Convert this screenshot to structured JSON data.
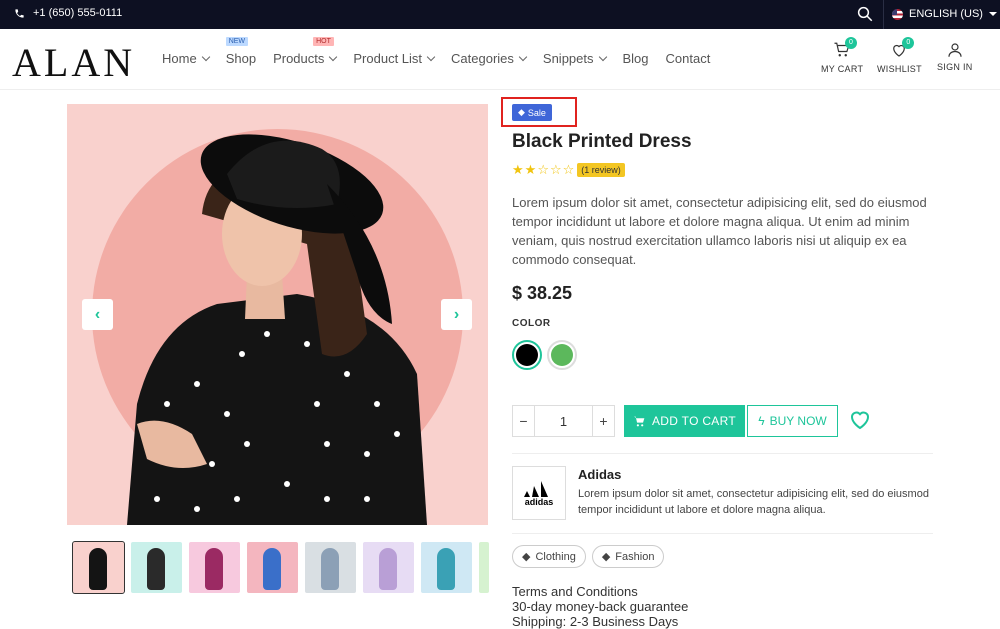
{
  "topbar": {
    "phone": "+1 (650) 555-0111",
    "language": "ENGLISH (US)"
  },
  "header": {
    "logo": "ALAN",
    "nav": [
      {
        "label": "Home",
        "dropdown": true
      },
      {
        "label": "Shop",
        "badge": "NEW",
        "dropdown": false
      },
      {
        "label": "Products",
        "badge": "HOT",
        "dropdown": true
      },
      {
        "label": "Product List",
        "dropdown": true
      },
      {
        "label": "Categories",
        "dropdown": true
      },
      {
        "label": "Snippets",
        "dropdown": true
      },
      {
        "label": "Blog",
        "dropdown": false
      },
      {
        "label": "Contact",
        "dropdown": false
      }
    ],
    "cart": {
      "label": "MY CART",
      "count": "0"
    },
    "wishlist": {
      "label": "WISHLIST",
      "count": "0"
    },
    "signin": {
      "label": "SIGN IN"
    }
  },
  "product": {
    "badge": "Sale",
    "title": "Black Printed Dress",
    "rating": 2,
    "rating_max": 5,
    "review_text": "(1 review)",
    "description": "Lorem ipsum dolor sit amet, consectetur adipisicing elit, sed do eiusmod tempor incididunt ut labore et dolore magna aliqua. Ut enim ad minim veniam, quis nostrud exercitation ullamco laboris nisi ut aliquip ex ea commodo consequat.",
    "price": "$ 38.25",
    "color_label": "COLOR",
    "colors": [
      "#000000",
      "#5cb85c"
    ],
    "quantity": "1",
    "add_to_cart": "ADD TO CART",
    "buy_now": "BUY NOW",
    "brand": {
      "name": "Adidas",
      "logo_text": "adidas",
      "description": "Lorem ipsum dolor sit amet, consectetur adipisicing elit, sed do eiusmod tempor incididunt ut labore et dolore magna aliqua."
    },
    "tags": [
      "Clothing",
      "Fashion"
    ],
    "terms": {
      "heading": "Terms and Conditions",
      "line1": "30-day money-back guarantee",
      "line2": "Shipping: 2-3 Business Days"
    }
  },
  "colors": {
    "accent": "#1ec59a",
    "sale_badge": "#3f66d8",
    "topbar": "#0d1022"
  }
}
